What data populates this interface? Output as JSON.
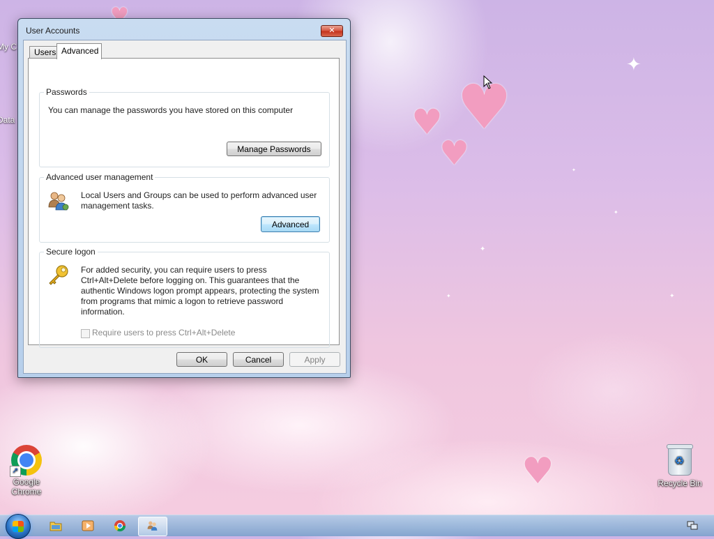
{
  "window": {
    "title": "User Accounts",
    "close_glyph": "✕",
    "tabs": [
      {
        "label": "Users",
        "active": false
      },
      {
        "label": "Advanced",
        "active": true
      }
    ],
    "passwords": {
      "title": "Passwords",
      "text": "You can manage the passwords you have stored on this computer",
      "button": "Manage Passwords"
    },
    "advanced_mgmt": {
      "title": "Advanced user management",
      "text": "Local Users and Groups can be used to perform advanced user management tasks.",
      "button": "Advanced",
      "icon": "users-group-icon"
    },
    "secure_logon": {
      "title": "Secure logon",
      "text": "For added security, you can require users to press Ctrl+Alt+Delete before logging on. This guarantees that the authentic Windows logon prompt appears, protecting the system from programs that mimic a logon to retrieve password information.",
      "checkbox_label": "Require users to press Ctrl+Alt+Delete",
      "checkbox_checked": false,
      "checkbox_enabled": false,
      "icon": "key-icon"
    },
    "buttons": {
      "ok": "OK",
      "cancel": "Cancel",
      "apply": "Apply"
    }
  },
  "desktop": {
    "icons": [
      {
        "label": "Google Chrome",
        "icon": "chrome-icon"
      },
      {
        "label": "Recycle Bin",
        "icon": "recycle-bin-icon"
      }
    ],
    "partial_labels": {
      "top": "My C",
      "second": "Data"
    }
  },
  "taskbar": {
    "items": [
      "windows-explorer",
      "media-player",
      "chrome",
      "user-accounts"
    ],
    "active": "user-accounts"
  }
}
